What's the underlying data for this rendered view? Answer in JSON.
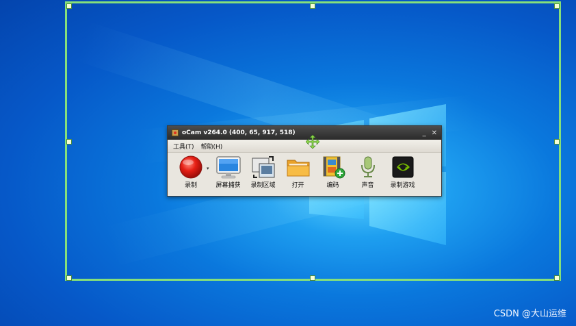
{
  "ocam_window": {
    "title": "oCam v264.0 (400, 65, 917, 518)",
    "minimize_glyph": "_",
    "close_glyph": "✕",
    "menu": [
      {
        "label": "工具(T)"
      },
      {
        "label": "帮助(H)"
      }
    ],
    "toolbar": {
      "record": {
        "label": "录制",
        "icon": "record-icon"
      },
      "screen_capture": {
        "label": "屏幕捕获",
        "icon": "monitor-icon"
      },
      "record_area": {
        "label": "录制区域",
        "icon": "region-resize-icon"
      },
      "open": {
        "label": "打开",
        "icon": "folder-icon"
      },
      "encode": {
        "label": "编码",
        "icon": "film-add-icon"
      },
      "sound": {
        "label": "声音",
        "icon": "microphone-icon"
      },
      "record_game": {
        "label": "录制游戏",
        "icon": "game-icon"
      }
    }
  },
  "capture_region": {
    "border_color": "#86e07a"
  },
  "watermark": {
    "text": "CSDN @大山运维"
  }
}
